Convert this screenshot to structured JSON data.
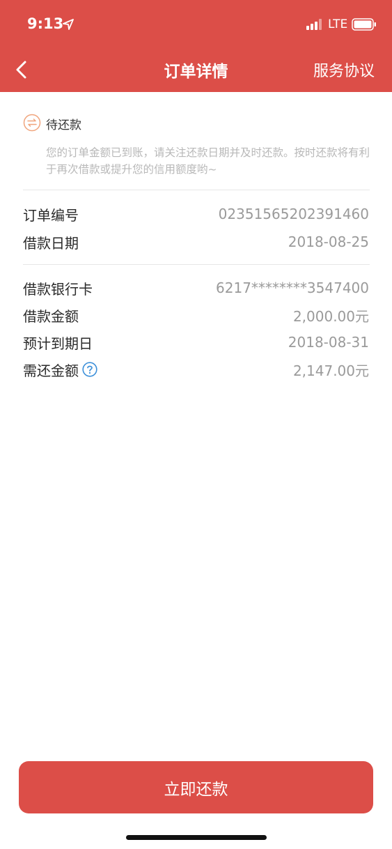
{
  "status_bar": {
    "time": "9:13",
    "network": "LTE",
    "icons": [
      "location-arrow-icon",
      "signal-icon",
      "battery-icon"
    ]
  },
  "nav": {
    "title": "订单详情",
    "right_link": "服务协议",
    "back_icon": "chevron-left-icon"
  },
  "order_status": {
    "label": "待还款",
    "icon": "exchange-arrows-icon",
    "description": "您的订单金额已到账，请关注还款日期并及时还款。按时还款将有利于再次借款或提升您的信用额度哟~"
  },
  "details": {
    "order_no_label": "订单编号",
    "order_no": "0235156520239146​0",
    "loan_date_label": "借款日期",
    "loan_date": "2018-08-25",
    "bank_card_label": "借款银行卡",
    "bank_card": "6217********3547400",
    "loan_amount_label": "借款金额",
    "loan_amount": "2,000.00元",
    "due_date_label": "预计到期日",
    "due_date": "2018-08-31",
    "repay_amount_label": "需还金额",
    "repay_amount": "2,147.00元",
    "help_icon": "question-circle-icon"
  },
  "actions": {
    "repay_label": "立即还款"
  },
  "colors": {
    "brand": "#dc4e48",
    "status_icon": "#f0a47c",
    "help_icon": "#3b8fd9",
    "value_text": "#9a9a9a"
  }
}
